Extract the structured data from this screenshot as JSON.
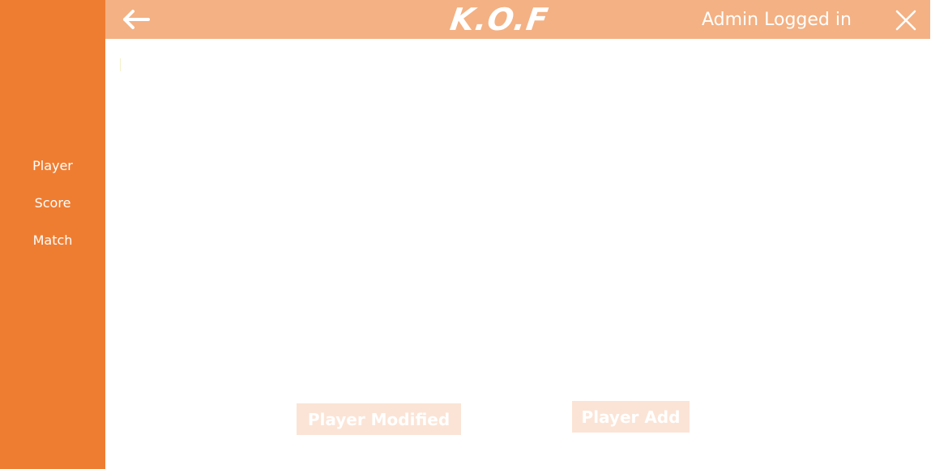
{
  "app": {
    "logo_text": "K.O.F",
    "accent_color": "#ef7d31",
    "header_color": "#f4b183"
  },
  "header": {
    "back_icon": "arrow-left-icon",
    "user_status": "Admin Logged in",
    "close_icon": "close-icon"
  },
  "sidebar": {
    "items": [
      {
        "label": "Player"
      },
      {
        "label": "Score"
      },
      {
        "label": "Match"
      }
    ]
  },
  "main": {
    "buttons": {
      "modified_label": "Player Modified",
      "add_label": "Player Add"
    }
  }
}
